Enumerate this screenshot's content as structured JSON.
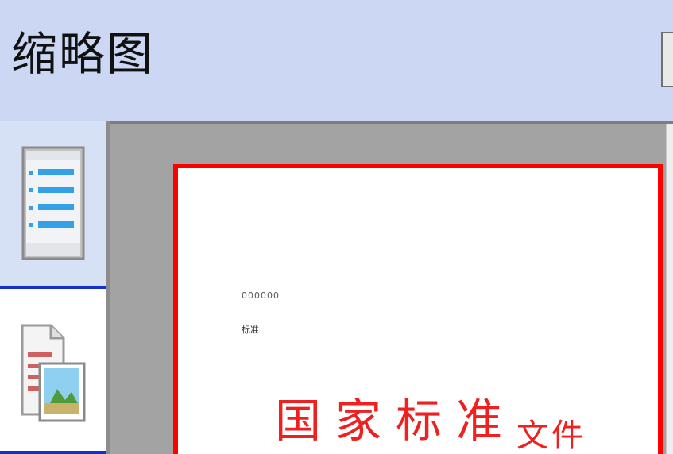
{
  "panel": {
    "title": "缩略图"
  },
  "sidebar": {
    "tabs": [
      {
        "name": "outline-view",
        "icon": "outline-list-icon",
        "selected": true
      },
      {
        "name": "thumbnail-view",
        "icon": "page-thumbnail-icon",
        "selected": false
      }
    ]
  },
  "document": {
    "code": "000000",
    "subtitle": "标准",
    "title": "国家标准",
    "title_tail": "文件"
  },
  "colors": {
    "header_bg": "#ccd7f4",
    "selected_tab_bg": "#d6e1f6",
    "tab_divider": "#1032c8",
    "preview_bg": "#a3a3a3",
    "page_border": "#ff0000",
    "title_red": "#ee2020"
  }
}
